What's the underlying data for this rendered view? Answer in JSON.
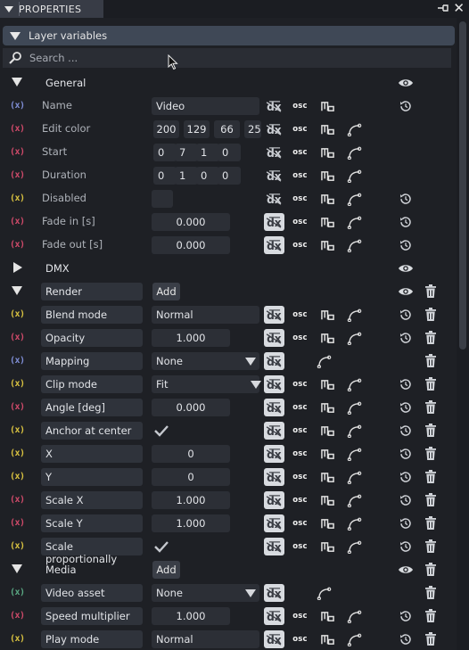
{
  "window": {
    "title": "PROPERTIES"
  },
  "section": {
    "title": "Layer variables"
  },
  "search": {
    "placeholder": "Search ..."
  },
  "colors": {
    "badge_purple": "#7f8ed6",
    "badge_red": "#d04a6a",
    "badge_yellow": "#d9c240",
    "badge_green": "#5aa883",
    "panel_bg": "#1e2025"
  },
  "groups": {
    "general": {
      "label": "General"
    },
    "dmx": {
      "label": "DMX"
    },
    "render": {
      "label": "Render",
      "add": "Add"
    },
    "media": {
      "label": "Media",
      "add": "Add"
    }
  },
  "general": {
    "name": {
      "badge": "(x)",
      "label": "Name",
      "value": "Video"
    },
    "edit_color": {
      "badge": "(x)",
      "label": "Edit color",
      "values": [
        "200",
        "129",
        "66",
        "25"
      ]
    },
    "start": {
      "badge": "(x)",
      "label": "Start",
      "values": [
        "0",
        "7",
        "1",
        "0"
      ]
    },
    "duration": {
      "badge": "(x)",
      "label": "Duration",
      "values": [
        "0",
        "1",
        "0",
        "0"
      ]
    },
    "disabled": {
      "badge": "(x)",
      "label": "Disabled"
    },
    "fade_in": {
      "badge": "(x)",
      "label": "Fade in [s]",
      "value": "0.000"
    },
    "fade_out": {
      "badge": "(x)",
      "label": "Fade out [s]",
      "value": "0.000"
    }
  },
  "render": {
    "blend_mode": {
      "badge": "(x)",
      "label": "Blend mode",
      "value": "Normal"
    },
    "opacity": {
      "badge": "(x)",
      "label": "Opacity",
      "value": "1.000"
    },
    "mapping": {
      "badge": "(x)",
      "label": "Mapping",
      "value": "None"
    },
    "clip_mode": {
      "badge": "(x)",
      "label": "Clip mode",
      "value": "Fit"
    },
    "angle": {
      "badge": "(x)",
      "label": "Angle [deg]",
      "value": "0.000"
    },
    "anchor": {
      "badge": "(x)",
      "label": "Anchor at center",
      "checked": true
    },
    "x": {
      "badge": "(x)",
      "label": "X",
      "value": "0"
    },
    "y": {
      "badge": "(x)",
      "label": "Y",
      "value": "0"
    },
    "scale_x": {
      "badge": "(x)",
      "label": "Scale X",
      "value": "1.000"
    },
    "scale_y": {
      "badge": "(x)",
      "label": "Scale Y",
      "value": "1.000"
    },
    "scale_prop": {
      "badge": "(x)",
      "label": "Scale proportionally",
      "checked": true
    }
  },
  "media": {
    "video_asset": {
      "badge": "(x)",
      "label": "Video asset",
      "value": "None"
    },
    "speed": {
      "badge": "(x)",
      "label": "Speed multiplier",
      "value": "1.000"
    },
    "play_mode": {
      "badge": "(x)",
      "label": "Play mode",
      "value": "Normal"
    }
  },
  "buttons": {
    "osc": "osc"
  }
}
